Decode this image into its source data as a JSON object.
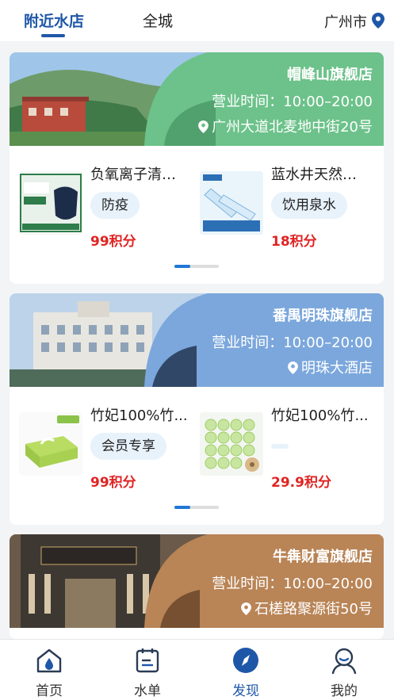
{
  "top_tabs": {
    "nearby": "附近水店",
    "citywide": "全城"
  },
  "city": "广州市",
  "stores": [
    {
      "name": "帽峰山旗舰店",
      "hours": "营业时间：10:00–20:00",
      "address": "广州大道北麦地中街20号",
      "accent": "#6cc28a",
      "products": [
        {
          "name": "负氧离子清新...",
          "tag": "防疫",
          "price": "99积分"
        },
        {
          "name": "蓝水井天然饮...",
          "tag": "饮用泉水",
          "price": "18积分"
        }
      ]
    },
    {
      "name": "番禺明珠旗舰店",
      "hours": "营业时间：10:00–20:00",
      "address": "明珠大酒店",
      "accent": "#7ba7dc",
      "products": [
        {
          "name": "竹妃100%竹...",
          "tag": "会员专享",
          "price": "99积分"
        },
        {
          "name": "竹妃100%竹...",
          "tag": "",
          "price": "29.9积分"
        }
      ]
    },
    {
      "name": "牛犇财富旗舰店",
      "hours": "营业时间：10:00–20:00",
      "address": "石槎路聚源街50号",
      "accent": "#b98456"
    }
  ],
  "bottom_nav": [
    {
      "label": "首页",
      "icon": "home-drop-icon"
    },
    {
      "label": "水单",
      "icon": "water-bill-icon"
    },
    {
      "label": "发现",
      "icon": "discover-compass-icon"
    },
    {
      "label": "我的",
      "icon": "profile-icon"
    }
  ],
  "colors": {
    "primary": "#1f57a8",
    "price": "#e02424",
    "tag_bg": "#e8f2fb"
  }
}
